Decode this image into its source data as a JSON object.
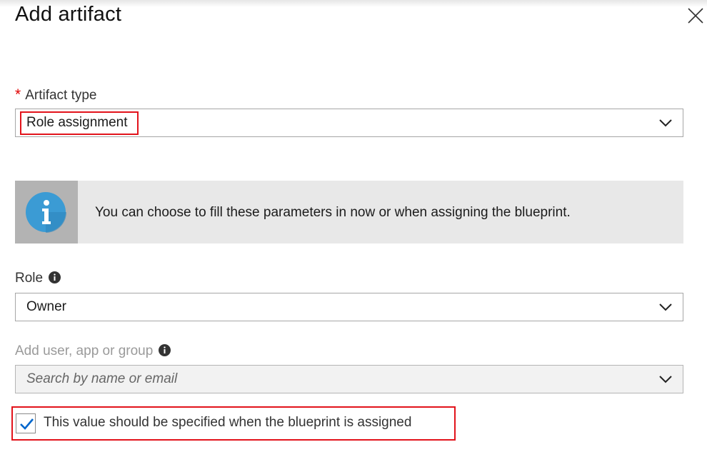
{
  "panel": {
    "title": "Add artifact"
  },
  "artifact_type": {
    "required_mark": "*",
    "label": "Artifact type",
    "value": "Role assignment"
  },
  "info_banner": {
    "text": "You can choose to fill these parameters in now or when assigning the blueprint."
  },
  "role": {
    "label": "Role",
    "value": "Owner"
  },
  "principal": {
    "label": "Add user, app or group",
    "placeholder": "Search by name or email"
  },
  "assign_option": {
    "checked": true,
    "label": "This value should be specified when the blueprint is assigned"
  },
  "colors": {
    "highlight": "#e2131b",
    "required": "#e00000",
    "info_icon": "#3b9bd4",
    "check": "#0066cc"
  },
  "icons": [
    "close-icon",
    "chevron-down-icon",
    "info-icon",
    "tooltip-info-icon",
    "checkmark-icon"
  ]
}
